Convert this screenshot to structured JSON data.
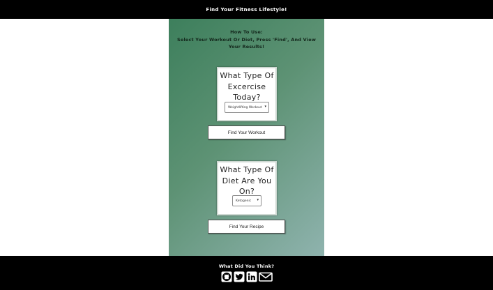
{
  "header": {
    "title": "Find Your Fitness Lifestyle!"
  },
  "howto": {
    "heading": "How To Use:",
    "instructions": "Select Your Workout Or Diet, Press 'Find', And View Your Results!"
  },
  "workout": {
    "question": "What Type Of Excercise Today?",
    "selected": "Weightlifting Workout",
    "button_label": "Find Your Workout"
  },
  "diet": {
    "question": "What Type Of Diet Are You On?",
    "selected": "Ketogenic",
    "button_label": "Find Your Recipe"
  },
  "footer": {
    "title": "What Did You Think?",
    "icons": [
      "github-icon",
      "twitter-icon",
      "linkedin-icon",
      "envelope-icon"
    ]
  },
  "colors": {
    "bar_background": "#000000",
    "panel_gradient_start": "#3d7f5c",
    "panel_gradient_end": "#8fb3ae"
  }
}
